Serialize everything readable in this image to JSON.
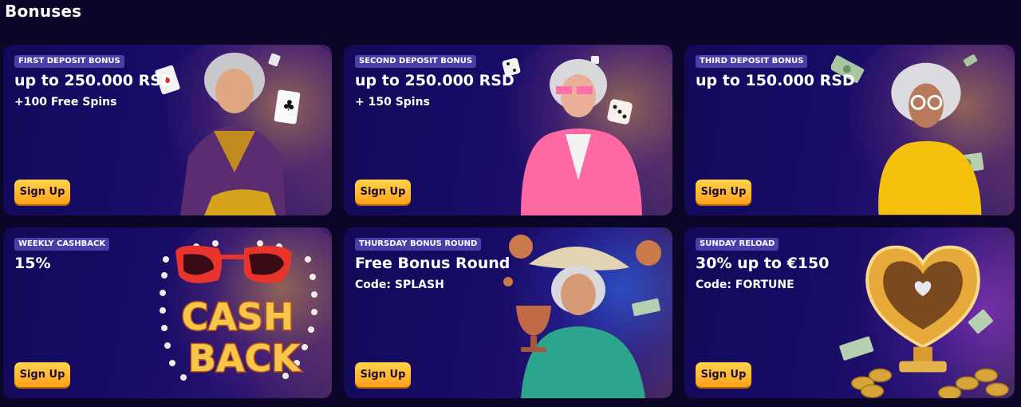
{
  "page": {
    "title": "Bonuses"
  },
  "cards": [
    {
      "badge": "FIRST DEPOSIT BONUS",
      "headline": "up to 250.000 RSD",
      "subline": "+100 Free Spins",
      "button": "Sign Up"
    },
    {
      "badge": "SECOND DEPOSIT BONUS",
      "headline": "up to 250.000 RSD",
      "subline": "+ 150 Spins",
      "button": "Sign Up"
    },
    {
      "badge": "THIRD DEPOSIT BONUS",
      "headline": "up to 150.000 RSD",
      "subline": "",
      "button": "Sign Up"
    },
    {
      "badge": "WEEKLY CASHBACK",
      "headline": "15%",
      "subline": "",
      "button": "Sign Up",
      "art_text": [
        "CASH",
        "BACK"
      ]
    },
    {
      "badge": "THURSDAY BONUS ROUND",
      "headline": "Free Bonus Round",
      "subline": "Code: SPLASH",
      "button": "Sign Up"
    },
    {
      "badge": "SUNDAY RELOAD",
      "headline": "30% up to €150",
      "subline": "Code: FORTUNE",
      "button": "Sign Up"
    }
  ],
  "colors": {
    "background": "#0b0627",
    "card": "#170c66",
    "badge": "#4a3fa8",
    "button": "#ffb023",
    "button_text": "#1a0d3a"
  },
  "icons": [
    "playing-card-icon",
    "dice-icon",
    "banknote-icon",
    "coin-icon",
    "trophy-cup-icon",
    "heart-trophy-icon",
    "sunglasses-icon"
  ]
}
